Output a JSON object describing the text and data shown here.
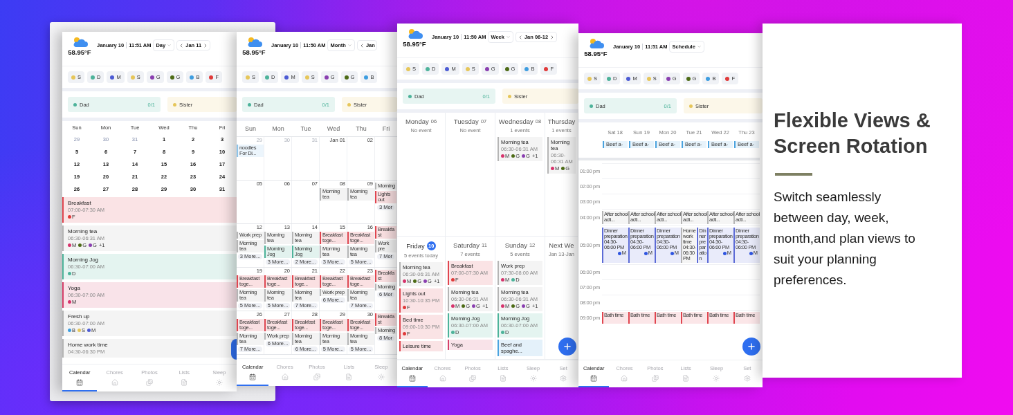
{
  "screens": [
    {
      "device_frame": true,
      "fab": {
        "kind": "edge"
      },
      "header": {
        "temperature": "58.95°F",
        "date": "January 10",
        "time": "11:51 AM",
        "view_label": "Day",
        "range": {
          "label": "Jan 11",
          "next": true
        }
      },
      "members": [
        {
          "initial": "S",
          "color": "#e6c65a"
        },
        {
          "initial": "D",
          "color": "#4db39a"
        },
        {
          "initial": "M",
          "color": "#4c5bd4"
        },
        {
          "initial": "S",
          "color": "#e6c65a"
        },
        {
          "initial": "G",
          "color": "#8a3fb0"
        },
        {
          "initial": "G",
          "color": "#4d6b16"
        },
        {
          "initial": "B",
          "color": "#3d9de0"
        },
        {
          "initial": "F",
          "color": "#e03a3a"
        }
      ],
      "chores": [
        {
          "name": "Dad",
          "color": "#4db39a",
          "count": "0/1"
        },
        {
          "name": "Sister",
          "color": "#e6c65a"
        }
      ],
      "body": {
        "kind": "day",
        "weekdays": [
          "Sun",
          "Mon",
          "Tue",
          "Wed",
          "Thu",
          "Fri"
        ],
        "weeks": [
          [
            {
              "date": "29",
              "other_month": true
            },
            {
              "date": "30",
              "other_month": true
            },
            {
              "date": "31",
              "other_month": true
            },
            {
              "date": "1",
              "other_month": false
            },
            {
              "date": "2",
              "other_month": false
            },
            {
              "date": "3",
              "other_month": false
            }
          ],
          [
            {
              "date": "5",
              "other_month": false
            },
            {
              "date": "6",
              "other_month": false
            },
            {
              "date": "7",
              "other_month": false
            },
            {
              "date": "8",
              "other_month": false
            },
            {
              "date": "9",
              "other_month": false
            },
            {
              "date": "10",
              "other_month": false
            }
          ],
          [
            {
              "date": "12",
              "other_month": false
            },
            {
              "date": "13",
              "other_month": false
            },
            {
              "date": "14",
              "other_month": false
            },
            {
              "date": "15",
              "other_month": false
            },
            {
              "date": "16",
              "other_month": false
            },
            {
              "date": "17",
              "other_month": false
            }
          ],
          [
            {
              "date": "19",
              "other_month": false
            },
            {
              "date": "20",
              "other_month": false
            },
            {
              "date": "21",
              "other_month": false
            },
            {
              "date": "22",
              "other_month": false
            },
            {
              "date": "23",
              "other_month": false
            },
            {
              "date": "24",
              "other_month": false
            }
          ],
          [
            {
              "date": "26",
              "other_month": false
            },
            {
              "date": "27",
              "other_month": false
            },
            {
              "date": "28",
              "other_month": false
            },
            {
              "date": "29",
              "other_month": false
            },
            {
              "date": "30",
              "other_month": false
            },
            {
              "date": "31",
              "other_month": false
            }
          ]
        ],
        "events": [
          {
            "title": "Breakfast",
            "time": "07:00-07:30 AM",
            "color": "#e0454f",
            "members": [
              {
                "initial": "F",
                "color": "#e03a3a"
              }
            ]
          },
          {
            "title": "Morning tea",
            "time": "06:30-06:31 AM",
            "color": "#b5b5b5",
            "members": [
              {
                "initial": "M",
                "color": "#d6336c"
              },
              {
                "initial": "G",
                "color": "#4d6b16"
              },
              {
                "initial": "G",
                "color": "#8a3fb0"
              }
            ],
            "extra": "+1"
          },
          {
            "title": "Morning Jog",
            "time": "06:30-07:00 AM",
            "color": "#4db39a",
            "members": [
              {
                "initial": "D",
                "color": "#4db39a"
              }
            ]
          },
          {
            "title": "Yoga",
            "time": "06:30-07:00 AM",
            "color": "#d6406a",
            "members": [
              {
                "initial": "M",
                "color": "#d6336c"
              }
            ]
          },
          {
            "title": "Fresh up",
            "time": "06:30-07:00 AM",
            "color": "#b5b5b5",
            "members": [
              {
                "initial": "B",
                "color": "#3d9de0"
              },
              {
                "initial": "S",
                "color": "#e6c65a"
              },
              {
                "initial": "M",
                "color": "#4c5bd4"
              }
            ]
          },
          {
            "title": "Home work time",
            "time": "04:30-06:30 PM",
            "color": "#b5b5b5"
          }
        ]
      },
      "nav": [
        {
          "label": "Calendar",
          "selected": true
        },
        {
          "label": "Chores",
          "selected": false
        },
        {
          "label": "Photos",
          "selected": false
        },
        {
          "label": "Lists",
          "selected": false
        },
        {
          "label": "Sleep",
          "selected": false
        }
      ]
    },
    {
      "device_frame": false,
      "header": {
        "temperature": "58.95°F",
        "date": "January 10",
        "time": "11:50 AM",
        "view_label": "Month",
        "range": {
          "label": "Jan",
          "next": false
        }
      },
      "members": [
        {
          "initial": "S",
          "color": "#e6c65a"
        },
        {
          "initial": "D",
          "color": "#4db39a"
        },
        {
          "initial": "M",
          "color": "#4c5bd4"
        },
        {
          "initial": "S",
          "color": "#e6c65a"
        },
        {
          "initial": "G",
          "color": "#8a3fb0"
        },
        {
          "initial": "G",
          "color": "#4d6b16"
        },
        {
          "initial": "B",
          "color": "#3d9de0"
        }
      ],
      "chores": [
        {
          "name": "Dad",
          "color": "#4db39a",
          "count": "0/1"
        },
        {
          "name": "Sister",
          "color": "#e6c65a"
        }
      ],
      "body": {
        "kind": "month",
        "weekdays": [
          "Sun",
          "Mon",
          "Tue",
          "Wed",
          "Thu",
          "Fri"
        ],
        "weeks": [
          [
            {
              "date": "29",
              "other_month": true,
              "events": [
                {
                  "title": "noodles For Di...",
                  "color": "#8cc4ea"
                }
              ]
            },
            {
              "date": "30",
              "other_month": true
            },
            {
              "date": "31",
              "other_month": true
            },
            {
              "date": "Jan 01",
              "other_month": false
            },
            {
              "date": "02",
              "other_month": false
            }
          ],
          [
            {
              "date": "05",
              "other_month": false
            },
            {
              "date": "06",
              "other_month": false
            },
            {
              "date": "07",
              "other_month": false
            },
            {
              "date": "08",
              "other_month": false,
              "events": [
                {
                  "title": "Morning tea",
                  "color": "#b5b5b5"
                }
              ]
            },
            {
              "date": "09",
              "other_month": false,
              "events": [
                {
                  "title": "Morning tea",
                  "color": "#b5b5b5"
                }
              ]
            },
            {
              "events": [
                {
                  "title": "Morning",
                  "color": "#b5b5b5"
                },
                {
                  "title": "Lights out",
                  "color": "#e0454f"
                }
              ],
              "more": "3 Mor"
            }
          ],
          [
            {
              "date": "12",
              "other_month": false,
              "events": [
                {
                  "title": "Work prep",
                  "color": "#b5b5b5"
                },
                {
                  "title": "Morning tea",
                  "color": "#b5b5b5"
                }
              ],
              "more": "3 More..."
            },
            {
              "date": "13",
              "other_month": false,
              "events": [
                {
                  "title": "Morning tea",
                  "color": "#b5b5b5"
                },
                {
                  "title": "Morning Jog",
                  "color": "#4db39a"
                }
              ],
              "more": "3 More..."
            },
            {
              "date": "14",
              "other_month": false,
              "events": [
                {
                  "title": "Morning tea",
                  "color": "#b5b5b5"
                },
                {
                  "title": "Morning Jog",
                  "color": "#4db39a"
                }
              ],
              "more": "2 More..."
            },
            {
              "date": "15",
              "other_month": false,
              "events": [
                {
                  "title": "Breakfast toge...",
                  "color": "#e0454f"
                },
                {
                  "title": "Morning tea",
                  "color": "#b5b5b5"
                }
              ],
              "more": "3 More..."
            },
            {
              "date": "16",
              "other_month": false,
              "events": [
                {
                  "title": "Breakfast toge...",
                  "color": "#e0454f"
                },
                {
                  "title": "Morning tea",
                  "color": "#b5b5b5"
                }
              ],
              "more": "5 More..."
            },
            {
              "events": [
                {
                  "title": "Breakfast",
                  "color": "#e0454f"
                },
                {
                  "title": "Work pre",
                  "color": "#b5b5b5"
                }
              ],
              "more": "7 Mor"
            }
          ],
          [
            {
              "date": "19",
              "other_month": false,
              "events": [
                {
                  "title": "Breakfast toge...",
                  "color": "#e0454f"
                },
                {
                  "title": "Morning tea",
                  "color": "#b5b5b5"
                }
              ],
              "more": "5 More..."
            },
            {
              "date": "20",
              "other_month": false,
              "events": [
                {
                  "title": "Breakfast toge...",
                  "color": "#e0454f"
                },
                {
                  "title": "Morning tea",
                  "color": "#b5b5b5"
                }
              ],
              "more": "5 More..."
            },
            {
              "date": "21",
              "other_month": false,
              "events": [
                {
                  "title": "Breakfast toge...",
                  "color": "#e0454f"
                },
                {
                  "title": "Morning tea",
                  "color": "#b5b5b5"
                }
              ],
              "more": "7 More..."
            },
            {
              "date": "22",
              "other_month": false,
              "events": [
                {
                  "title": "Breakfast toge...",
                  "color": "#e0454f"
                },
                {
                  "title": "Work prep",
                  "color": "#b5b5b5"
                }
              ],
              "more": "6 More..."
            },
            {
              "date": "23",
              "other_month": false,
              "events": [
                {
                  "title": "Breakfast toge...",
                  "color": "#e0454f"
                },
                {
                  "title": "Morning tea",
                  "color": "#b5b5b5"
                }
              ],
              "more": "7 More..."
            },
            {
              "events": [
                {
                  "title": "Breakfast",
                  "color": "#e0454f"
                },
                {
                  "title": "Morning",
                  "color": "#b5b5b5"
                }
              ],
              "more": "6 Mor"
            }
          ],
          [
            {
              "date": "26",
              "other_month": false,
              "events": [
                {
                  "title": "Breakfast toge...",
                  "color": "#e0454f"
                },
                {
                  "title": "Morning tea",
                  "color": "#b5b5b5"
                }
              ],
              "more": "7 More..."
            },
            {
              "date": "27",
              "other_month": false,
              "events": [
                {
                  "title": "Breakfast toge...",
                  "color": "#e0454f"
                },
                {
                  "title": "Work prep",
                  "color": "#b5b5b5"
                }
              ],
              "more": "6 More..."
            },
            {
              "date": "28",
              "other_month": false,
              "events": [
                {
                  "title": "Breakfast toge...",
                  "color": "#e0454f"
                },
                {
                  "title": "Morning tea",
                  "color": "#b5b5b5"
                }
              ],
              "more": "6 More..."
            },
            {
              "date": "29",
              "other_month": false,
              "events": [
                {
                  "title": "Breakfast toge...",
                  "color": "#e0454f"
                },
                {
                  "title": "Morning tea",
                  "color": "#b5b5b5"
                }
              ],
              "more": "5 More..."
            },
            {
              "date": "30",
              "other_month": false,
              "events": [
                {
                  "title": "Breakfast toge...",
                  "color": "#e0454f"
                },
                {
                  "title": "Morning tea",
                  "color": "#b5b5b5"
                }
              ],
              "more": "5 More..."
            },
            {
              "events": [
                {
                  "title": "Breakfast",
                  "color": "#e0454f"
                },
                {
                  "title": "Morning",
                  "color": "#b5b5b5"
                }
              ],
              "more": "8 Mor"
            }
          ]
        ]
      },
      "nav": [
        {
          "label": "Calendar",
          "selected": true
        },
        {
          "label": "Chores",
          "selected": false
        },
        {
          "label": "Photos",
          "selected": false
        },
        {
          "label": "Lists",
          "selected": false
        },
        {
          "label": "Sleep",
          "selected": false
        }
      ]
    },
    {
      "device_frame": false,
      "fab": {
        "kind": "full"
      },
      "header": {
        "temperature": "58.95°F",
        "date": "January 10",
        "time": "11:50 AM",
        "view_label": "Week",
        "range": {
          "label": "Jan 06-12",
          "next": true
        }
      },
      "members": [
        {
          "initial": "S",
          "color": "#e6c65a"
        },
        {
          "initial": "D",
          "color": "#4db39a"
        },
        {
          "initial": "M",
          "color": "#4c5bd4"
        },
        {
          "initial": "S",
          "color": "#e6c65a"
        },
        {
          "initial": "G",
          "color": "#8a3fb0"
        },
        {
          "initial": "G",
          "color": "#4d6b16"
        },
        {
          "initial": "B",
          "color": "#3d9de0"
        },
        {
          "initial": "F",
          "color": "#e03a3a"
        }
      ],
      "chores": [
        {
          "name": "Dad",
          "color": "#4db39a",
          "count": "0/1"
        },
        {
          "name": "Sister",
          "color": "#e6c65a"
        }
      ],
      "body": {
        "kind": "week",
        "rows": [
          [
            {
              "name": "Monday",
              "num": "06",
              "today": false,
              "summary": "No event"
            },
            {
              "name": "Tuesday",
              "num": "07",
              "today": false,
              "summary": "No event"
            },
            {
              "name": "Wednesday",
              "num": "08",
              "today": false,
              "summary": "1 events",
              "events": [
                {
                  "title": "Morning tea",
                  "time": "06:30-06:31 AM",
                  "color": "#b5b5b5",
                  "members": [
                    {
                      "initial": "M",
                      "color": "#d6336c"
                    },
                    {
                      "initial": "G",
                      "color": "#4d6b16"
                    },
                    {
                      "initial": "G",
                      "color": "#8a3fb0"
                    }
                  ],
                  "extra": "+1"
                }
              ]
            },
            {
              "name": "Thursday",
              "today": false,
              "summary": "1 events",
              "events": [
                {
                  "title": "Morning tea",
                  "time": "06:30-06:31 AM",
                  "color": "#b5b5b5",
                  "members": [
                    {
                      "initial": "M",
                      "color": "#d6336c"
                    },
                    {
                      "initial": "G",
                      "color": "#4d6b16"
                    }
                  ]
                }
              ]
            }
          ],
          [
            {
              "name": "Friday",
              "num": "10",
              "today": true,
              "summary": "5 events today",
              "events": [
                {
                  "title": "Morning tea",
                  "time": "06:30-06:31 AM",
                  "color": "#b5b5b5",
                  "members": [
                    {
                      "initial": "M",
                      "color": "#d6336c"
                    },
                    {
                      "initial": "G",
                      "color": "#4d6b16"
                    },
                    {
                      "initial": "G",
                      "color": "#8a3fb0"
                    }
                  ],
                  "extra": "+1"
                },
                {
                  "title": "Lights out",
                  "time": "10:30-10:35 PM",
                  "color": "#e0454f",
                  "members": [
                    {
                      "initial": "F",
                      "color": "#e03a3a"
                    }
                  ]
                },
                {
                  "title": "Bed time",
                  "time": "09:00-10:30 PM",
                  "color": "#e0454f",
                  "members": [
                    {
                      "initial": "F",
                      "color": "#e03a3a"
                    }
                  ]
                },
                {
                  "title": "Leisure time",
                  "color": "#e0454f"
                }
              ]
            },
            {
              "name": "Saturday",
              "num": "11",
              "today": false,
              "summary": "7 events",
              "events": [
                {
                  "title": "Breakfast",
                  "time": "07:00-07:30 AM",
                  "color": "#e0454f",
                  "members": [
                    {
                      "initial": "F",
                      "color": "#e03a3a"
                    }
                  ]
                },
                {
                  "title": "Morning tea",
                  "time": "06:30-06:31 AM",
                  "color": "#b5b5b5",
                  "members": [
                    {
                      "initial": "M",
                      "color": "#d6336c"
                    },
                    {
                      "initial": "G",
                      "color": "#4d6b16"
                    },
                    {
                      "initial": "G",
                      "color": "#8a3fb0"
                    }
                  ],
                  "extra": "+1"
                },
                {
                  "title": "Morning Jog",
                  "time": "06:30-07:00 AM",
                  "color": "#4db39a",
                  "members": [
                    {
                      "initial": "D",
                      "color": "#4db39a"
                    }
                  ]
                },
                {
                  "title": "Yoga",
                  "color": "#d6406a"
                }
              ]
            },
            {
              "name": "Sunday",
              "num": "12",
              "today": false,
              "summary": "5 events",
              "events": [
                {
                  "title": "Work prep",
                  "time": "07:30-08:00 AM",
                  "color": "#b5b5b5",
                  "members": [
                    {
                      "initial": "M",
                      "color": "#d6336c"
                    },
                    {
                      "initial": "D",
                      "color": "#4db39a"
                    }
                  ]
                },
                {
                  "title": "Morning tea",
                  "time": "06:30-06:31 AM",
                  "color": "#b5b5b5",
                  "members": [
                    {
                      "initial": "M",
                      "color": "#d6336c"
                    },
                    {
                      "initial": "G",
                      "color": "#4d6b16"
                    },
                    {
                      "initial": "G",
                      "color": "#8a3fb0"
                    }
                  ],
                  "extra": "+1"
                },
                {
                  "title": "Morning Jog",
                  "time": "06:30-07:00 AM",
                  "color": "#4db39a",
                  "members": [
                    {
                      "initial": "D",
                      "color": "#4db39a"
                    }
                  ]
                },
                {
                  "title": "Beef and spaghe...",
                  "color": "#4aa3df"
                }
              ]
            },
            {
              "name": "Next We",
              "today": false,
              "summary": "Jan 13-Jan"
            }
          ]
        ]
      },
      "nav": [
        {
          "label": "Calendar",
          "selected": true
        },
        {
          "label": "Chores",
          "selected": false
        },
        {
          "label": "Photos",
          "selected": false
        },
        {
          "label": "Lists",
          "selected": false
        },
        {
          "label": "Sleep",
          "selected": false
        },
        {
          "label": "Set",
          "selected": false
        }
      ]
    },
    {
      "device_frame": false,
      "fab": {
        "kind": "full"
      },
      "header": {
        "temperature": "58.95°F",
        "date": "January 10",
        "time": "11:51 AM",
        "view_label": "Schedule"
      },
      "members": [
        {
          "initial": "S",
          "color": "#e6c65a"
        },
        {
          "initial": "D",
          "color": "#4db39a"
        },
        {
          "initial": "M",
          "color": "#4c5bd4"
        },
        {
          "initial": "S",
          "color": "#e6c65a"
        },
        {
          "initial": "G",
          "color": "#8a3fb0"
        },
        {
          "initial": "G",
          "color": "#4d6b16"
        },
        {
          "initial": "B",
          "color": "#3d9de0"
        },
        {
          "initial": "F",
          "color": "#e03a3a"
        }
      ],
      "chores": [
        {
          "name": "Dad",
          "color": "#4db39a",
          "count": "0/1"
        },
        {
          "name": "Sister",
          "color": "#e6c65a"
        }
      ],
      "body": {
        "kind": "schedule",
        "days": [
          "Sat 18",
          "Sun 19",
          "Mon 20",
          "Tue 21",
          "Wed 22",
          "Thu 23"
        ],
        "all_day": [
          {
            "title": "Beef a-",
            "color": "#4aa3df"
          },
          {
            "title": "Beef a-",
            "color": "#4aa3df"
          },
          {
            "title": "Beef a-",
            "color": "#4aa3df"
          },
          {
            "title": "Beef a-",
            "color": "#4aa3df"
          },
          {
            "title": "Beef a-",
            "color": "#4aa3df"
          },
          {
            "title": "Beef a-",
            "color": "#4aa3df"
          }
        ],
        "hours": [
          {
            "label": "01:00 pm"
          },
          {
            "label": "02:00 pm"
          },
          {
            "label": "03:00 pm"
          },
          {
            "label": "04:00 pm",
            "cells": [
              [
                {
                  "title": "After school acti...",
                  "color": "#b5b5b5"
                }
              ],
              [
                {
                  "title": "After school acti...",
                  "color": "#b5b5b5"
                }
              ],
              [
                {
                  "title": "After school acti...",
                  "color": "#b5b5b5"
                }
              ],
              [
                {
                  "title": "After school acti...",
                  "color": "#b5b5b5"
                }
              ],
              [
                {
                  "title": "After school acti...",
                  "color": "#b5b5b5"
                }
              ],
              [
                {
                  "title": "After school acti...",
                  "color": "#b5b5b5"
                }
              ]
            ]
          },
          {
            "label": "05:00 pm",
            "cells": [
              [
                {
                  "title": "Dinner preparation",
                  "time": "04:30-06:00 PM",
                  "color": "#5c6bd6",
                  "members": [
                    {
                      "initial": "M",
                      "color": "#2f55e0"
                    }
                  ]
                }
              ],
              [
                {
                  "title": "Dinner preparation",
                  "time": "04:30-06:00 PM",
                  "color": "#5c6bd6",
                  "members": [
                    {
                      "initial": "M",
                      "color": "#2f55e0"
                    }
                  ]
                }
              ],
              [
                {
                  "title": "Dinner preparation",
                  "time": "04:30-06:00 PM",
                  "color": "#5c6bd6",
                  "members": [
                    {
                      "initial": "M",
                      "color": "#2f55e0"
                    }
                  ]
                }
              ],
              [
                {
                  "title": "Home work time",
                  "time": "04:30-06:30 PM",
                  "color": "#b5b5b5"
                },
                {
                  "title": "Dinner preparation",
                  "color": "#5c6bd6"
                }
              ],
              [
                {
                  "title": "Dinner preparation",
                  "time": "04:30-06:00 PM",
                  "color": "#5c6bd6",
                  "members": [
                    {
                      "initial": "M",
                      "color": "#2f55e0"
                    }
                  ]
                }
              ],
              [
                {
                  "title": "Dinner preparation",
                  "time": "04:30-06:00 PM",
                  "color": "#5c6bd6",
                  "members": [
                    {
                      "initial": "M",
                      "color": "#2f55e0"
                    }
                  ]
                }
              ]
            ]
          },
          {
            "label": "06:00 pm"
          },
          {
            "label": "07:00 pm"
          },
          {
            "label": "08:00 pm"
          },
          {
            "label": "09:00 pm",
            "cells": [
              [
                {
                  "title": "Bath time",
                  "color": "#e0454f"
                }
              ],
              [
                {
                  "title": "Bath time",
                  "color": "#e0454f"
                }
              ],
              [
                {
                  "title": "Bath time",
                  "color": "#e0454f"
                }
              ],
              [
                {
                  "title": "Bath time",
                  "color": "#e0454f"
                }
              ],
              [
                {
                  "title": "Bath time",
                  "color": "#e0454f"
                }
              ],
              [
                {
                  "title": "Bath time",
                  "color": "#e0454f"
                }
              ]
            ]
          }
        ]
      },
      "nav": [
        {
          "label": "Calendar",
          "selected": true
        },
        {
          "label": "Chores",
          "selected": false
        },
        {
          "label": "Photos",
          "selected": false
        },
        {
          "label": "Lists",
          "selected": false
        },
        {
          "label": "Sleep",
          "selected": false
        },
        {
          "label": "Set",
          "selected": false
        }
      ]
    }
  ],
  "promo": {
    "title": "Flexible Views & Screen Rotation",
    "text": "Switch seamlessly between day, week, month,and plan views to suit your planning preferences."
  }
}
